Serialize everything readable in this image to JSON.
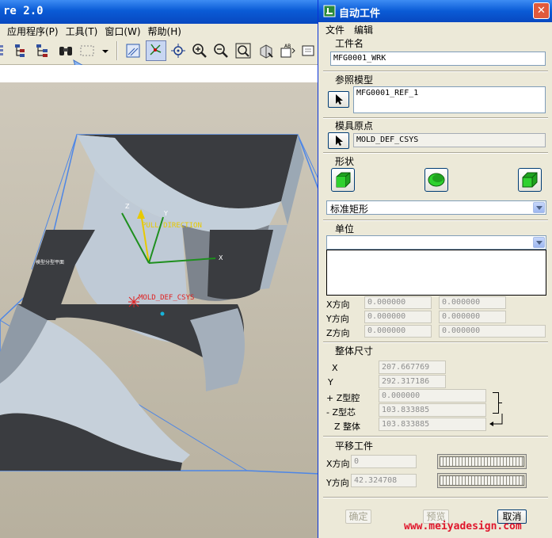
{
  "app": {
    "title_fragment": "re 2.0",
    "menu": [
      "应用程序(P)",
      "工具(T)",
      "窗口(W)",
      "帮助(H)"
    ],
    "toolbar_icons": [
      "layer-tree-icon",
      "model-tree-icon",
      "binoculars-icon",
      "selection-box-icon",
      "dropdown-arrow-icon",
      "spin-center-icon",
      "datum-planes-icon",
      "datum-csys-icon",
      "zoom-in-icon",
      "zoom-out-icon",
      "refit-icon",
      "orient-icon",
      "saved-views-icon",
      "repaint-icon"
    ]
  },
  "viewport": {
    "labels": {
      "pull_direction": "PULL DIRECTION",
      "csys_name": "MOLD_DEF_CSYS",
      "axis_x": "X",
      "axis_y": "Y",
      "axis_z": "Z",
      "side_label": "模型分型平面"
    },
    "colors": {
      "model_face": "#b9c6d2",
      "model_dark": "#3a3c40",
      "bbox": "#4d86e6",
      "pull_dir": "#e8c900",
      "csys": "#e02020",
      "axes": "#1e8f1e"
    }
  },
  "dialog": {
    "title": "自动工件",
    "close_glyph": "✕",
    "menu": [
      "文件",
      "编辑"
    ],
    "workpiece_name_label": "工件名",
    "workpiece_name": "MFG0001_WRK",
    "ref_model_label": "参照模型",
    "ref_model": "MFG0001_REF_1",
    "mold_origin_label": "模具原点",
    "mold_origin": "MOLD_DEF_CSYS",
    "shape_label": "形状",
    "shape_icons": [
      "cube-shape-icon",
      "cylinder-shape-icon",
      "custom-shape-icon"
    ],
    "shape_selected": "标准矩形",
    "unit_label": "单位",
    "unit_value": "",
    "offsets": {
      "rows": [
        {
          "label": "X方向",
          "neg": "0.000000",
          "pos": "0.000000"
        },
        {
          "label": "Y方向",
          "neg": "0.000000",
          "pos": "0.000000"
        },
        {
          "label": "Z方向",
          "neg": "0.000000",
          "pos": "0.000000"
        }
      ]
    },
    "overall_size": {
      "label": "整体尺寸",
      "x_label": "X",
      "x": "207.667769",
      "y_label": "Y",
      "y": "292.317186",
      "z_cavity_label": "+ Z型腔",
      "z_cavity": "0.000000",
      "z_core_label": "- Z型芯",
      "z_core": "103.833885",
      "z_total_label": "Z 整体",
      "z_total": "103.833885"
    },
    "translate": {
      "label": "平移工件",
      "x_label": "X方向",
      "x": "0",
      "y_label": "Y方向",
      "y": "42.324708"
    },
    "buttons": {
      "ok": "确定",
      "preview": "预览",
      "cancel": "取消"
    }
  },
  "watermark": "www.meiyadesign.com"
}
